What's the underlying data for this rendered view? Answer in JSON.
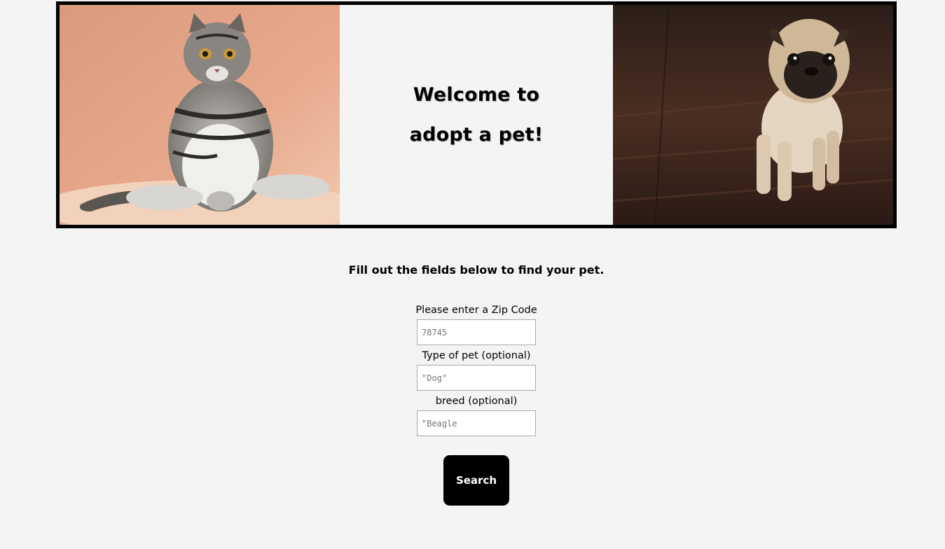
{
  "banner": {
    "left_image": "cat-photo",
    "right_image": "pug-photo",
    "welcome_line1": "Welcome to",
    "welcome_line2": "adopt a pet!"
  },
  "intro": "Fill out the fields below to find your pet.",
  "form": {
    "zip_label": "Please enter a Zip Code",
    "zip_placeholder": "78745",
    "type_label": "Type of pet (optional)",
    "type_placeholder": "\"Dog\"",
    "breed_label": "breed (optional)",
    "breed_placeholder": "\"Beagle",
    "search_label": "Search"
  },
  "colors": {
    "background": "#f4f4f4",
    "button": "#000000",
    "button_text": "#ffffff",
    "border": "#000000"
  }
}
